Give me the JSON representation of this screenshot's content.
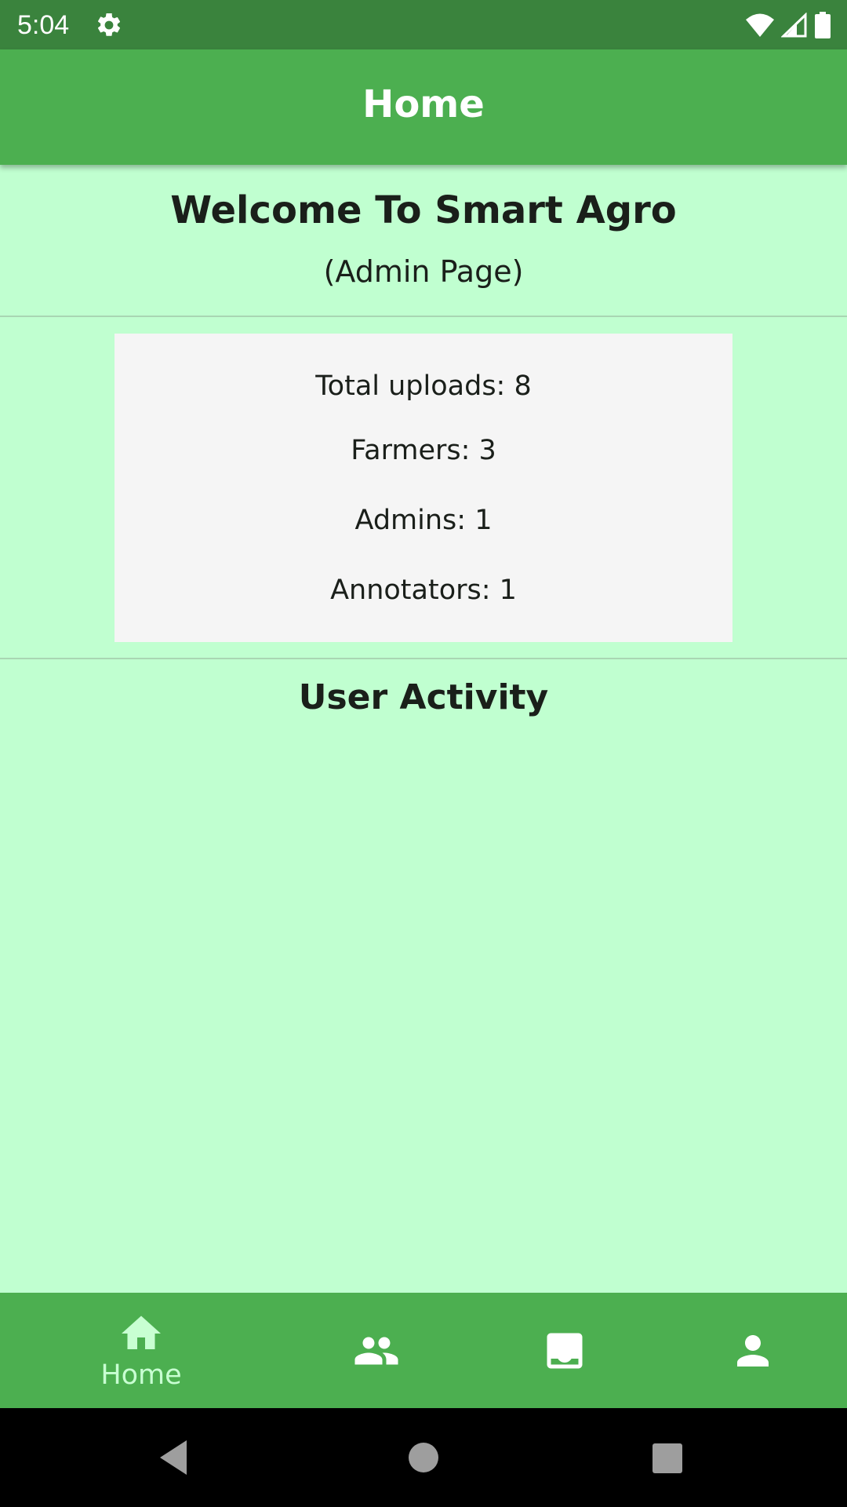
{
  "status_bar": {
    "time": "5:04",
    "icons": [
      "settings-icon",
      "wifi-icon",
      "signal-icon",
      "battery-icon"
    ]
  },
  "app_bar": {
    "title": "Home"
  },
  "welcome": {
    "title": "Welcome To Smart Agro",
    "subtitle": "(Admin Page)"
  },
  "stats": {
    "total_uploads": "Total uploads: 8",
    "farmers": "Farmers: 3",
    "admins": "Admins: 1",
    "annotators": "Annotators: 1"
  },
  "activity": {
    "title": "User Activity"
  },
  "bottom_nav": {
    "items": [
      {
        "label": "Home",
        "icon": "home-icon",
        "selected": true
      },
      {
        "label": "",
        "icon": "people-icon",
        "selected": false
      },
      {
        "label": "",
        "icon": "upload-icon",
        "selected": false
      },
      {
        "label": "",
        "icon": "person-icon",
        "selected": false
      }
    ]
  },
  "system_nav": {
    "buttons": [
      "back-icon",
      "home-circle-icon",
      "recents-icon"
    ]
  },
  "colors": {
    "status_bar": "#3a833d",
    "primary": "#4caf50",
    "background": "#c0ffd0",
    "card": "#f5f5f5",
    "selected_nav": "#c8ffd2"
  }
}
